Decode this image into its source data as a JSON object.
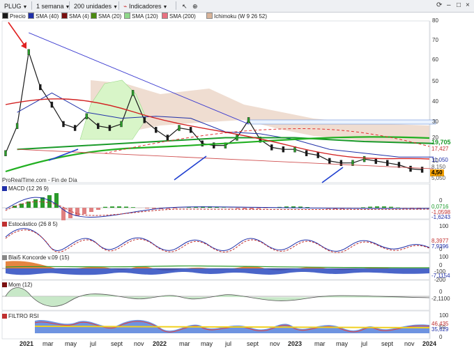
{
  "toolbar": {
    "symbol": "PLUG",
    "period": "1 semana",
    "units": "200 unidades",
    "indicators": "Indicadores"
  },
  "legend": [
    {
      "label": "Precio",
      "color": "#1a1a1a"
    },
    {
      "label": "SMA (40)",
      "color": "#1f2fa8"
    },
    {
      "label": "SMA (4)",
      "color": "#7a1010"
    },
    {
      "label": "SMA (20)",
      "color": "#4a8a10"
    },
    {
      "label": "SMA (120)",
      "color": "#8fd88a"
    },
    {
      "label": "SMA (200)",
      "color": "#e87080"
    },
    {
      "label": "Ichimoku (W 9 26 52)",
      "color": "#d9b49a"
    }
  ],
  "source_text": "ProRealTime.com - Fin de Día",
  "price_panel": {
    "y_ticks": [
      "80",
      "70",
      "60",
      "50",
      "40",
      "30",
      "20",
      "10"
    ],
    "labels": [
      {
        "text": "19,705",
        "bg": "#ffffff",
        "color": "#1a9a2a",
        "kind": "value"
      },
      {
        "text": "17,427",
        "bg": "#ffffff",
        "color": "#c03030",
        "kind": "value"
      },
      {
        "text": "11,050",
        "bg": "#ffffff",
        "color": "#1f2fa8",
        "kind": "value"
      },
      {
        "text": "8,150",
        "bg": "#ffffff",
        "color": "#555555",
        "kind": "value"
      },
      {
        "text": "4,50",
        "bg": "#f2a000",
        "color": "#000000",
        "kind": "last"
      },
      {
        "text": "5,050",
        "bg": "#ffffff",
        "color": "#555555",
        "kind": "value"
      }
    ]
  },
  "macd_panel": {
    "title": "MACD (12 26 9)",
    "y_ticks": [
      "0"
    ],
    "labels": [
      {
        "text": "0,0716",
        "color": "#1a9a2a"
      },
      {
        "text": "-1,0598",
        "color": "#c03030"
      },
      {
        "text": "-1,6243",
        "color": "#1f2fa8"
      }
    ]
  },
  "stoch_panel": {
    "title": "Estocástico (26 8 5)",
    "y_ticks": [
      "100",
      "0"
    ],
    "labels": [
      {
        "text": "8,3977",
        "color": "#c03030"
      },
      {
        "text": "7,9396",
        "color": "#1f2fa8"
      }
    ]
  },
  "koncorde_panel": {
    "title": "Blai5 Koncorde v.09 (15)",
    "y_ticks": [
      "100",
      "0",
      "-100",
      "-200"
    ],
    "labels": [
      {
        "text": "-7,1154",
        "color": "#1f2fa8"
      }
    ]
  },
  "mom_panel": {
    "title": "Mom (12)",
    "y_ticks": [
      "0"
    ],
    "labels": [
      {
        "text": "-2,1100",
        "color": "#333333"
      }
    ]
  },
  "rsi_panel": {
    "title": "FILTRO RSI",
    "y_ticks": [
      "100",
      "50",
      "0"
    ],
    "labels": [
      {
        "text": "46,435",
        "color": "#c03030"
      },
      {
        "text": "35,629",
        "color": "#1f2fa8"
      }
    ]
  },
  "x_axis": [
    {
      "text": "2021",
      "major": true
    },
    {
      "text": "mar",
      "major": false
    },
    {
      "text": "may",
      "major": false
    },
    {
      "text": "jul",
      "major": false
    },
    {
      "text": "sept",
      "major": false
    },
    {
      "text": "nov",
      "major": false
    },
    {
      "text": "2022",
      "major": true
    },
    {
      "text": "mar",
      "major": false
    },
    {
      "text": "may",
      "major": false
    },
    {
      "text": "jul",
      "major": false
    },
    {
      "text": "sept",
      "major": false
    },
    {
      "text": "nov",
      "major": false
    },
    {
      "text": "2023",
      "major": true
    },
    {
      "text": "mar",
      "major": false
    },
    {
      "text": "may",
      "major": false
    },
    {
      "text": "jul",
      "major": false
    },
    {
      "text": "sept",
      "major": false
    },
    {
      "text": "nov",
      "major": false
    },
    {
      "text": "2024",
      "major": true
    }
  ],
  "chart_data": {
    "type": "line",
    "title": "PLUG",
    "x_period": "weekly",
    "x_range": [
      "2021-01",
      "2024-01"
    ],
    "ylim": [
      0,
      80
    ],
    "grid": false,
    "series": [
      {
        "name": "Precio",
        "x": [
          "2020-12",
          "2021-01",
          "2021-02",
          "2021-03",
          "2021-04",
          "2021-05",
          "2021-06",
          "2021-07",
          "2021-08",
          "2021-09",
          "2021-10",
          "2021-11",
          "2021-12",
          "2022-01",
          "2022-02",
          "2022-03",
          "2022-04",
          "2022-05",
          "2022-06",
          "2022-07",
          "2022-08",
          "2022-09",
          "2022-10",
          "2022-11",
          "2022-12",
          "2023-01",
          "2023-02",
          "2023-03",
          "2023-04",
          "2023-05",
          "2023-06",
          "2023-07",
          "2023-08",
          "2023-09",
          "2023-10",
          "2023-11",
          "2023-12"
        ],
        "values": [
          13,
          27,
          65,
          47,
          38,
          28,
          26,
          32,
          27,
          26,
          28,
          44,
          30,
          25,
          21,
          26,
          25,
          18,
          17,
          17,
          21,
          30,
          20,
          16,
          15,
          15,
          13,
          12,
          9,
          8,
          8,
          10,
          9,
          8,
          7,
          5,
          4.5
        ]
      },
      {
        "name": "SMA (40)",
        "x": [
          "2021-01",
          "2021-04",
          "2021-07",
          "2021-10",
          "2022-01",
          "2022-04",
          "2022-07",
          "2022-10",
          "2023-01",
          "2023-04",
          "2023-07",
          "2023-10",
          "2024-01"
        ],
        "values": [
          34,
          44,
          34,
          31,
          32,
          31,
          24,
          23,
          20,
          15,
          13,
          11,
          11
        ]
      },
      {
        "name": "SMA (200)",
        "x": [
          "2021-01",
          "2021-07",
          "2022-01",
          "2022-07",
          "2023-01",
          "2023-07",
          "2024-01"
        ],
        "values": [
          15,
          17,
          19,
          21,
          21,
          19,
          18
        ]
      }
    ],
    "annotations": [
      {
        "type": "trendline",
        "label": "",
        "from": [
          "2021-02",
          75
        ],
        "to": [
          "2022-09",
          28
        ]
      },
      {
        "type": "trendline",
        "label": "",
        "from": [
          "2021-01",
          15
        ],
        "to": [
          "2024-01",
          5
        ]
      }
    ]
  }
}
